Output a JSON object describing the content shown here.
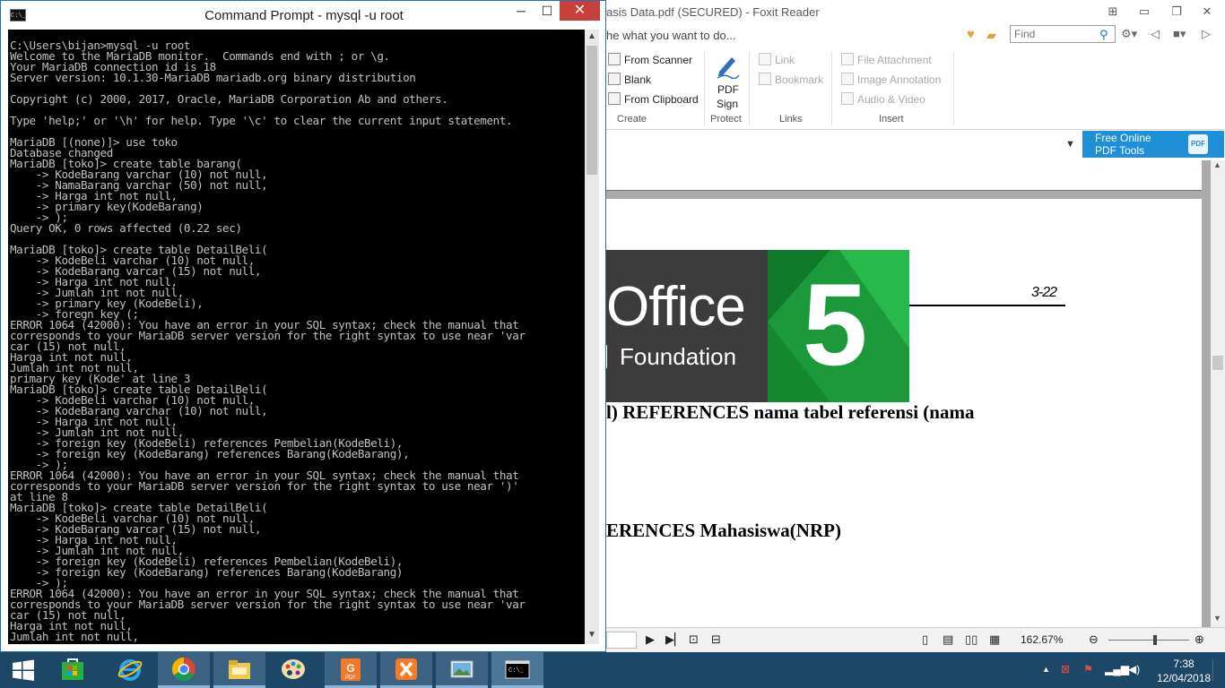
{
  "cmd": {
    "title": "Command Prompt - mysql  -u root",
    "icon_label": "C:\\_",
    "buttons": {
      "minimize": "─",
      "maximize": "☐",
      "close": "✕"
    },
    "console_lines": [
      "C:\\Users\\bijan>mysql -u root",
      "Welcome to the MariaDB monitor.  Commands end with ; or \\g.",
      "Your MariaDB connection id is 18",
      "Server version: 10.1.30-MariaDB mariadb.org binary distribution",
      "",
      "Copyright (c) 2000, 2017, Oracle, MariaDB Corporation Ab and others.",
      "",
      "Type 'help;' or '\\h' for help. Type '\\c' to clear the current input statement.",
      "",
      "MariaDB [(none)]> use toko",
      "Database changed",
      "MariaDB [toko]> create table barang(",
      "    -> KodeBarang varchar (10) not null,",
      "    -> NamaBarang varchar (50) not null,",
      "    -> Harga int not null,",
      "    -> primary key(KodeBarang)",
      "    -> );",
      "Query OK, 0 rows affected (0.22 sec)",
      "",
      "MariaDB [toko]> create table DetailBeli(",
      "    -> KodeBeli varchar (10) not null,",
      "    -> KodeBarang varcar (15) not null,",
      "    -> Harga int not null,",
      "    -> Jumlah int not null,",
      "    -> primary key (KodeBeli),",
      "    -> foregn key (;",
      "ERROR 1064 (42000): You have an error in your SQL syntax; check the manual that",
      "corresponds to your MariaDB server version for the right syntax to use near 'var",
      "car (15) not null,",
      "Harga int not null,",
      "Jumlah int not null,",
      "primary key (Kode' at line 3",
      "MariaDB [toko]> create table DetailBeli(",
      "    -> KodeBeli varchar (10) not null,",
      "    -> KodeBarang varchar (10) not null,",
      "    -> Harga int not null,",
      "    -> Jumlah int not null,",
      "    -> foreign key (KodeBeli) references Pembelian(KodeBeli),",
      "    -> foreign key (KodeBarang) references Barang(KodeBarang),",
      "    -> );",
      "ERROR 1064 (42000): You have an error in your SQL syntax; check the manual that",
      "corresponds to your MariaDB server version for the right syntax to use near ')'",
      "at line 8",
      "MariaDB [toko]> create table DetailBeli(",
      "    -> KodeBeli varchar (10) not null,",
      "    -> KodeBarang varcar (15) not null,",
      "    -> Harga int not null,",
      "    -> Jumlah int not null,",
      "    -> foreign key (KodeBeli) references Pembelian(KodeBeli),",
      "    -> foreign key (KodeBarang) references Barang(KodeBarang)",
      "    -> );",
      "ERROR 1064 (42000): You have an error in your SQL syntax; check the manual that",
      "corresponds to your MariaDB server version for the right syntax to use near 'var",
      "car (15) not null,",
      "Harga int not null,",
      "Jumlah int not null,"
    ]
  },
  "foxit": {
    "title": "asis Data.pdf (SECURED) - Foxit Reader",
    "tell_me": "he what you want to do...",
    "search": {
      "placeholder": "Find"
    },
    "ribbon": {
      "create": {
        "items": [
          "From Scanner",
          "Blank",
          "From Clipboard"
        ],
        "group": "Create"
      },
      "protect": {
        "button_line1": "PDF",
        "button_line2": "Sign",
        "group": "Protect"
      },
      "links": {
        "items": [
          "Link",
          "Bookmark"
        ],
        "group": "Links"
      },
      "insert": {
        "items": [
          "File Attachment",
          "Image Annotation",
          "Audio & Video"
        ],
        "group": "Insert"
      }
    },
    "ad": {
      "line1": "Free Online",
      "line2": "PDF Tools",
      "badge": "PDF"
    },
    "page": {
      "logo_word": "Office",
      "logo_sub": "Foundation",
      "logo_version": "5",
      "page_number": "3-22",
      "line1": "l) REFERENCES nama tabel referensi (nama",
      "line2": "ERENCES Mahasiswa(NRP)"
    },
    "status": {
      "zoom": "162.67%"
    }
  },
  "taskbar": {
    "apps": [
      {
        "name": "Store",
        "active": false
      },
      {
        "name": "Internet Explorer",
        "active": false
      },
      {
        "name": "Chrome",
        "active": false
      },
      {
        "name": "File Explorer",
        "active": false
      },
      {
        "name": "Paint",
        "active": false
      },
      {
        "name": "Foxit Reader",
        "active": false
      },
      {
        "name": "XAMPP",
        "active": false
      },
      {
        "name": "Photos",
        "active": false
      },
      {
        "name": "Command Prompt",
        "active": true
      }
    ],
    "time": "7:38",
    "date": "12/04/2018"
  },
  "colors": {
    "console_bg": "#000000",
    "console_text": "#c0c0c0",
    "taskbar": "#1d4766",
    "close_button": "#c7403a",
    "ad_blue": "#1f8fd8",
    "logo_green": "#1c9a3b"
  }
}
